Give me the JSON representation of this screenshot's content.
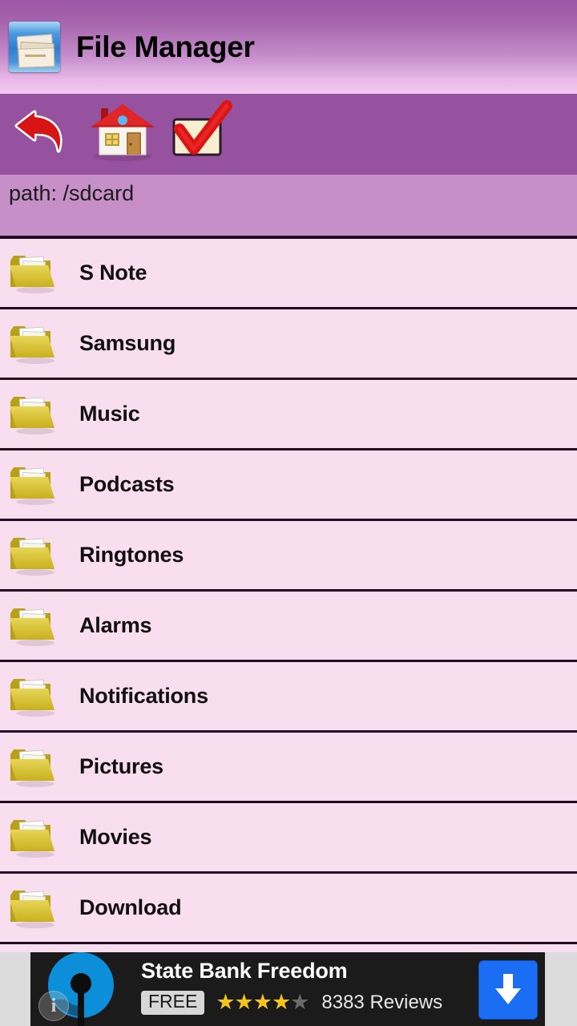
{
  "app": {
    "title": "File Manager",
    "icon": "file-cabinet-icon",
    "colors": {
      "titlebar_top": "#9C56A5",
      "titlebar_bottom": "#F3C8F0",
      "toolbar": "#96519F",
      "pathbar": "#C68FC8",
      "list_background": "#F9DEF0",
      "divider": "#240A22",
      "ad_accent": "#1B6EF3",
      "star_on": "#F5C518"
    }
  },
  "toolbar": {
    "buttons": [
      {
        "name": "back-button",
        "icon": "back-arrow-icon",
        "label": "Back"
      },
      {
        "name": "home-button",
        "icon": "home-icon",
        "label": "Home"
      },
      {
        "name": "select-button",
        "icon": "checkbox-checked-icon",
        "label": "Select"
      }
    ]
  },
  "pathbar": {
    "text": "path: /sdcard",
    "label": "path:",
    "value": "/sdcard"
  },
  "file_list": {
    "items": [
      {
        "name": "S Note",
        "type": "folder",
        "icon": "folder-icon"
      },
      {
        "name": "Samsung",
        "type": "folder",
        "icon": "folder-icon"
      },
      {
        "name": "Music",
        "type": "folder",
        "icon": "folder-icon"
      },
      {
        "name": "Podcasts",
        "type": "folder",
        "icon": "folder-icon"
      },
      {
        "name": "Ringtones",
        "type": "folder",
        "icon": "folder-icon"
      },
      {
        "name": "Alarms",
        "type": "folder",
        "icon": "folder-icon"
      },
      {
        "name": "Notifications",
        "type": "folder",
        "icon": "folder-icon"
      },
      {
        "name": "Pictures",
        "type": "folder",
        "icon": "folder-icon"
      },
      {
        "name": "Movies",
        "type": "folder",
        "icon": "folder-icon"
      },
      {
        "name": "Download",
        "type": "folder",
        "icon": "folder-icon"
      }
    ]
  },
  "ad": {
    "title": "State Bank Freedom",
    "price_badge": "FREE",
    "rating": 4,
    "rating_max": 5,
    "stars_filled": "★★★★",
    "stars_empty": "★",
    "reviews": "8383 Reviews",
    "review_count": "8383",
    "logo": "sbi-logo-icon",
    "download_icon": "download-arrow-icon",
    "info_icon": "info-icon",
    "info_glyph": "i"
  }
}
